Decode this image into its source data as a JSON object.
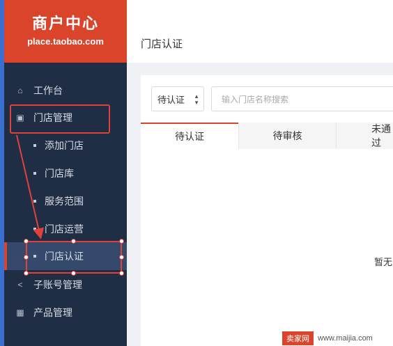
{
  "brand": {
    "title": "商户中心",
    "subtitle": "place.taobao.com"
  },
  "sidebar": {
    "items": [
      {
        "label": "工作台",
        "icon": "home-icon"
      },
      {
        "label": "门店管理",
        "icon": "store-icon"
      },
      {
        "label": "添加门店"
      },
      {
        "label": "门店库"
      },
      {
        "label": "服务范围"
      },
      {
        "label": "门店运营"
      },
      {
        "label": "门店认证",
        "active": true
      },
      {
        "label": "子账号管理",
        "icon": "share-icon"
      },
      {
        "label": "产品管理",
        "icon": "grid-icon"
      }
    ]
  },
  "header": {
    "title": "门店认证"
  },
  "filters": {
    "status_value": "待认证",
    "search_placeholder": "输入门店名称搜索"
  },
  "tabs": [
    {
      "label": "待认证"
    },
    {
      "label": "待审核"
    },
    {
      "label": "未通过"
    }
  ],
  "empty_state": {
    "text": "暂无"
  },
  "watermark": {
    "brand": "卖家网",
    "url": "www.maijia.com"
  },
  "colors": {
    "brand": "#d9442b",
    "sidebar": "#1f2e45",
    "annotation": "#e0413a"
  }
}
